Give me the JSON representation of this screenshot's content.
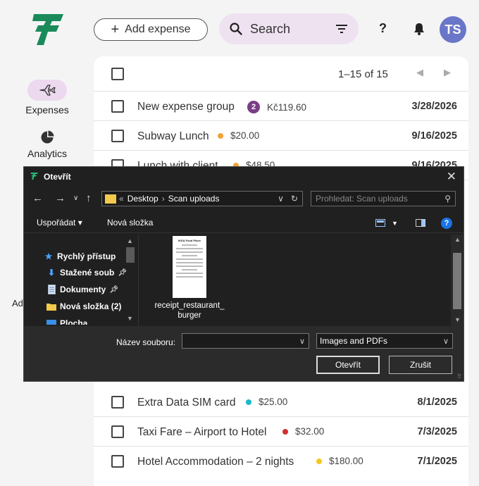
{
  "nav": {
    "items": [
      {
        "label": "Expenses",
        "icon": "plane-icon",
        "active": true
      },
      {
        "label": "Analytics",
        "icon": "pie-chart-icon",
        "active": false
      }
    ],
    "partial_label": "Ad"
  },
  "topbar": {
    "add_label": "Add expense",
    "search_placeholder": "Search",
    "help_label": "?",
    "avatar_initials": "TS",
    "avatar_color": "#6a76c7"
  },
  "list": {
    "pager": "1–15 of 15",
    "rows": [
      {
        "title": "New expense group",
        "badge": "2",
        "amount": "Kč119.60",
        "date": "3/28/2026",
        "dot": ""
      },
      {
        "title": "Subway Lunch",
        "dot": "#f4a13a",
        "amount": "$20.00",
        "date": "9/16/2025"
      },
      {
        "title": "Lunch with client",
        "dot": "#f4a13a",
        "amount": "$48.50",
        "date": "9/16/2025"
      },
      {
        "title": "Extra Data SIM card",
        "dot": "#17b8cc",
        "amount": "$25.00",
        "date": "8/1/2025"
      },
      {
        "title": "Taxi Fare – Airport to Hotel",
        "dot": "#d32f2f",
        "amount": "$32.00",
        "date": "7/3/2025"
      },
      {
        "title": "Hotel Accommodation – 2 nights",
        "dot": "#f7c81e",
        "amount": "$180.00",
        "date": "7/1/2025"
      }
    ]
  },
  "dialog": {
    "title": "Otevřít",
    "path": [
      "Desktop",
      "Scan uploads"
    ],
    "path_prefix": "«",
    "search_placeholder": "Prohledat: Scan uploads",
    "organize_label": "Uspořádat ▾",
    "new_folder_label": "Nová složka",
    "tree": [
      {
        "label": "Rychlý přístup",
        "icon": "star-icon",
        "bold": true,
        "pinned": false
      },
      {
        "label": "Stažené soub",
        "icon": "download-icon",
        "bold": true,
        "pinned": true
      },
      {
        "label": "Dokumenty",
        "icon": "document-icon",
        "bold": true,
        "pinned": true
      },
      {
        "label": "Nová složka (2)",
        "icon": "folder-icon",
        "bold": true,
        "pinned": false
      },
      {
        "label": "Plocha",
        "icon": "desktop-icon",
        "bold": true,
        "pinned": false
      }
    ],
    "file": {
      "name": "receipt_restaurant_burger",
      "thumb_header": "IKEA Food Place"
    },
    "filename_label": "Název souboru:",
    "filename_value": "",
    "filetype": "Images and PDFs",
    "open_label": "Otevřít",
    "cancel_label": "Zrušit",
    "accent": "#1a73e8"
  },
  "colors": {
    "brand_green": "#1a8a5a",
    "active_pill": "#ecd8ef",
    "badge": "#7a3e86"
  }
}
